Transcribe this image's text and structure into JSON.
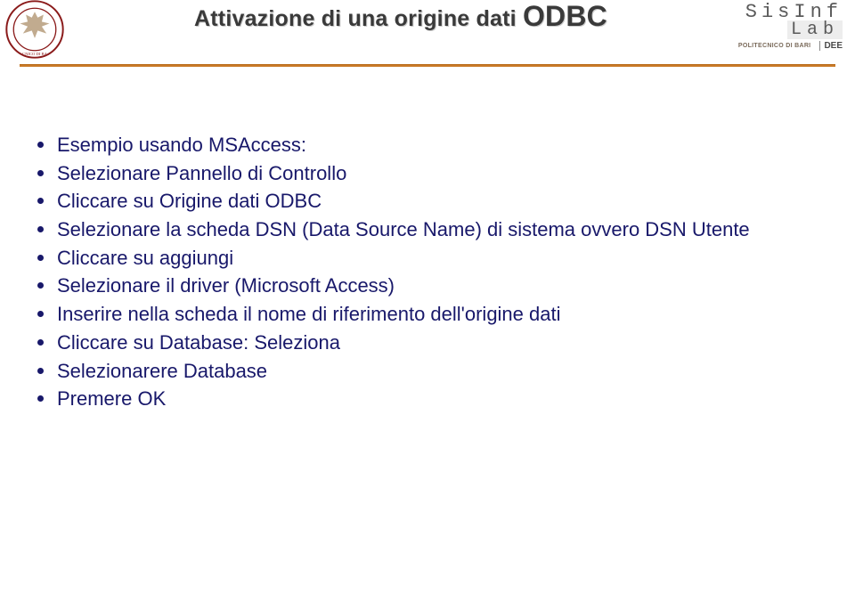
{
  "header": {
    "title_prefix": "Attivazione di una origine dati ",
    "title_suffix": "ODBC",
    "brand_line1": "SisInf",
    "brand_line2": "Lab",
    "brand_sub1": "POLITECNICO DI BARI",
    "brand_sub2": "DEE"
  },
  "bullets": [
    "Esempio usando MSAccess:",
    "Selezionare Pannello di Controllo",
    "Cliccare su Origine dati ODBC",
    "Selezionare la scheda DSN (Data Source Name) di sistema ovvero DSN Utente",
    "Cliccare su aggiungi",
    "Selezionare il driver (Microsoft Access)",
    "Inserire nella scheda il nome di riferimento dell'origine dati",
    "Cliccare su Database: Seleziona",
    "Selezionarere Database",
    "Premere OK"
  ]
}
